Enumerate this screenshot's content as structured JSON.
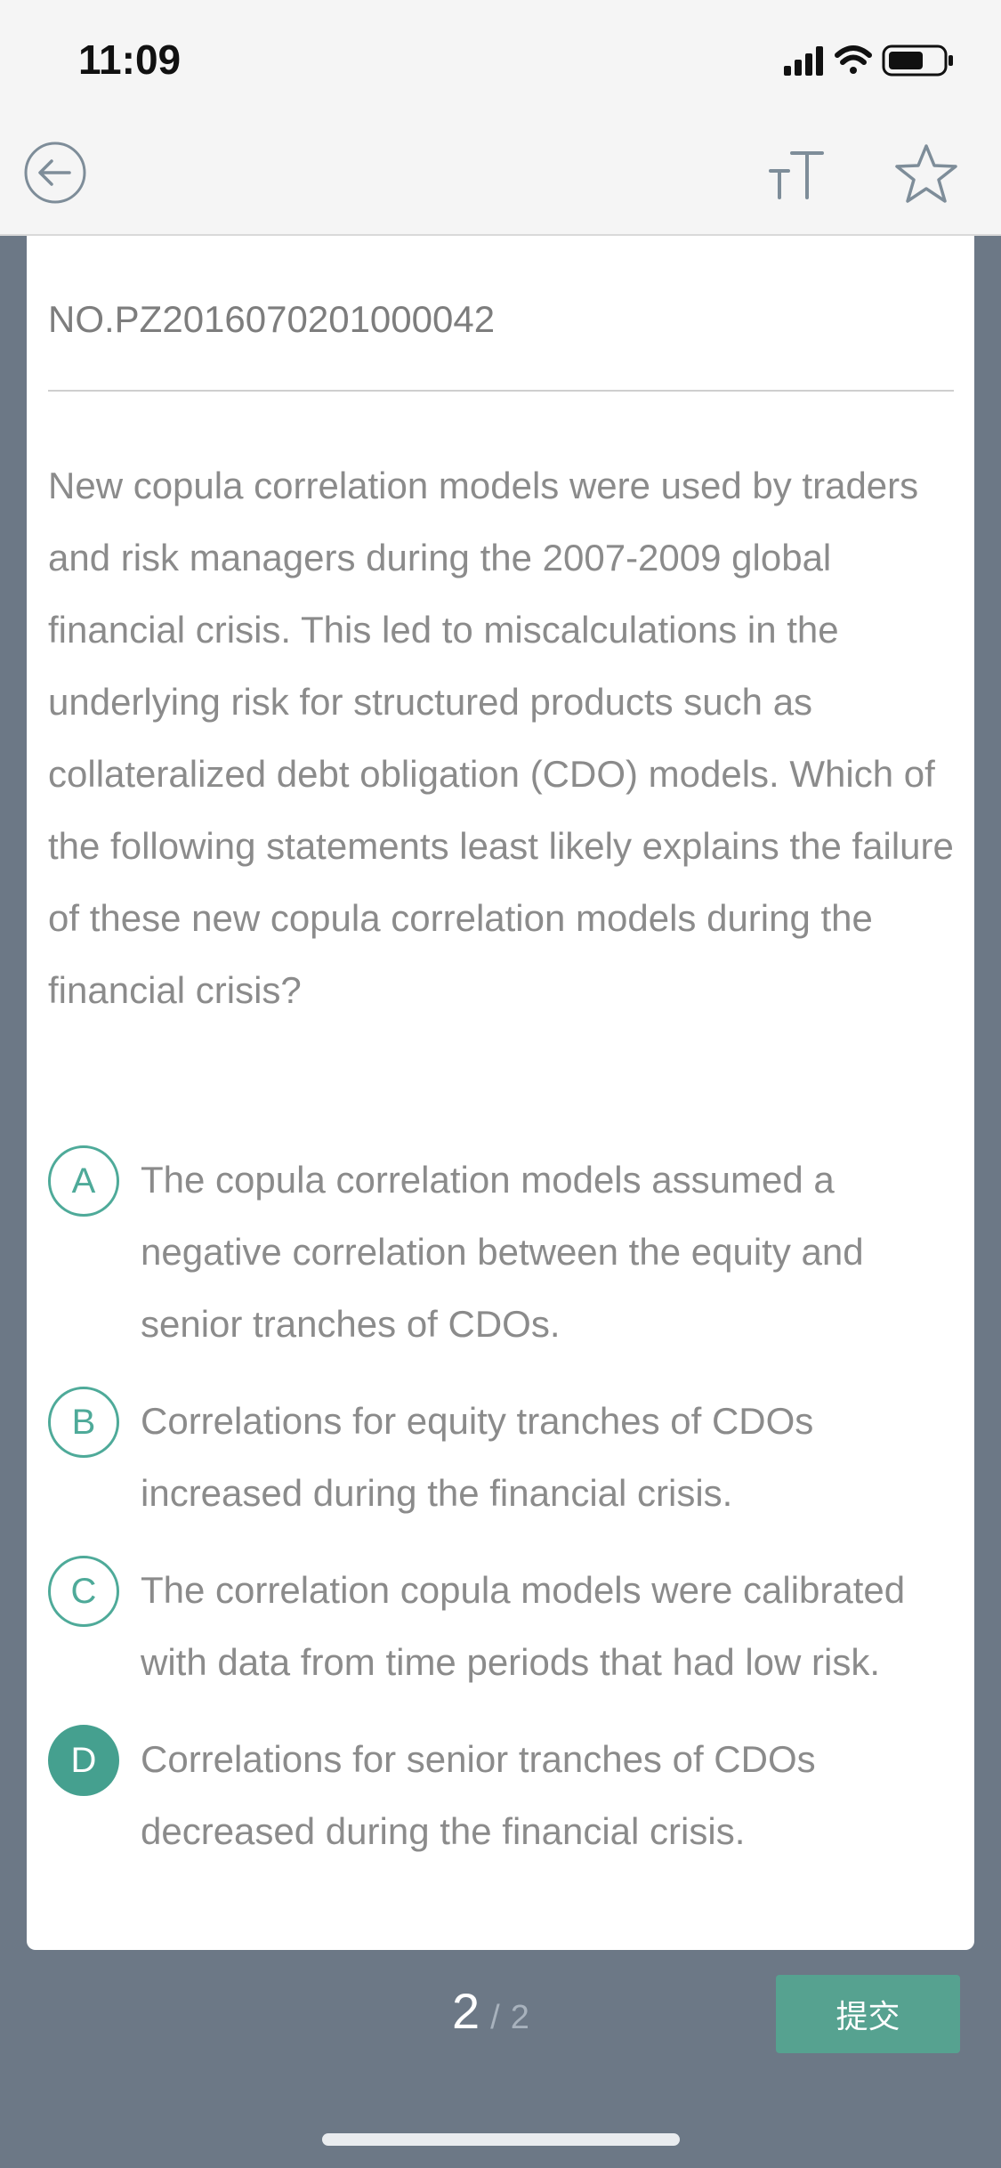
{
  "status_bar": {
    "time": "11:09"
  },
  "nav": {
    "back_icon": "back-arrow-circle-icon",
    "font_size_icon": "text-size-icon",
    "favorite_icon": "star-outline-icon"
  },
  "question": {
    "number": "NO.PZ2016070201000042",
    "text": "New copula correlation models were used by traders and risk managers during the 2007-2009 global financial crisis. This led to miscalculations in the underlying risk for structured products such as collateralized debt obligation (CDO) models. Which of the following statements least likely explains the failure of these new copula correlation models during the financial crisis?"
  },
  "options": [
    {
      "letter": "A",
      "text": "The copula correlation models assumed a negative correlation between the equity and senior tranches of CDOs.",
      "selected": false
    },
    {
      "letter": "B",
      "text": "Correlations for equity tranches of CDOs increased during the financial crisis.",
      "selected": false
    },
    {
      "letter": "C",
      "text": "The correlation copula models were calibrated with data from time periods that had low risk.",
      "selected": false
    },
    {
      "letter": "D",
      "text": "Correlations for senior tranches of CDOs decreased during the financial crisis.",
      "selected": true
    }
  ],
  "pagination": {
    "current": "2",
    "separator": "/",
    "total": "2"
  },
  "submit_label": "提交",
  "colors": {
    "accent": "#45a08f",
    "page_bg": "#6c7886",
    "header_bg": "#f5f5f5"
  }
}
